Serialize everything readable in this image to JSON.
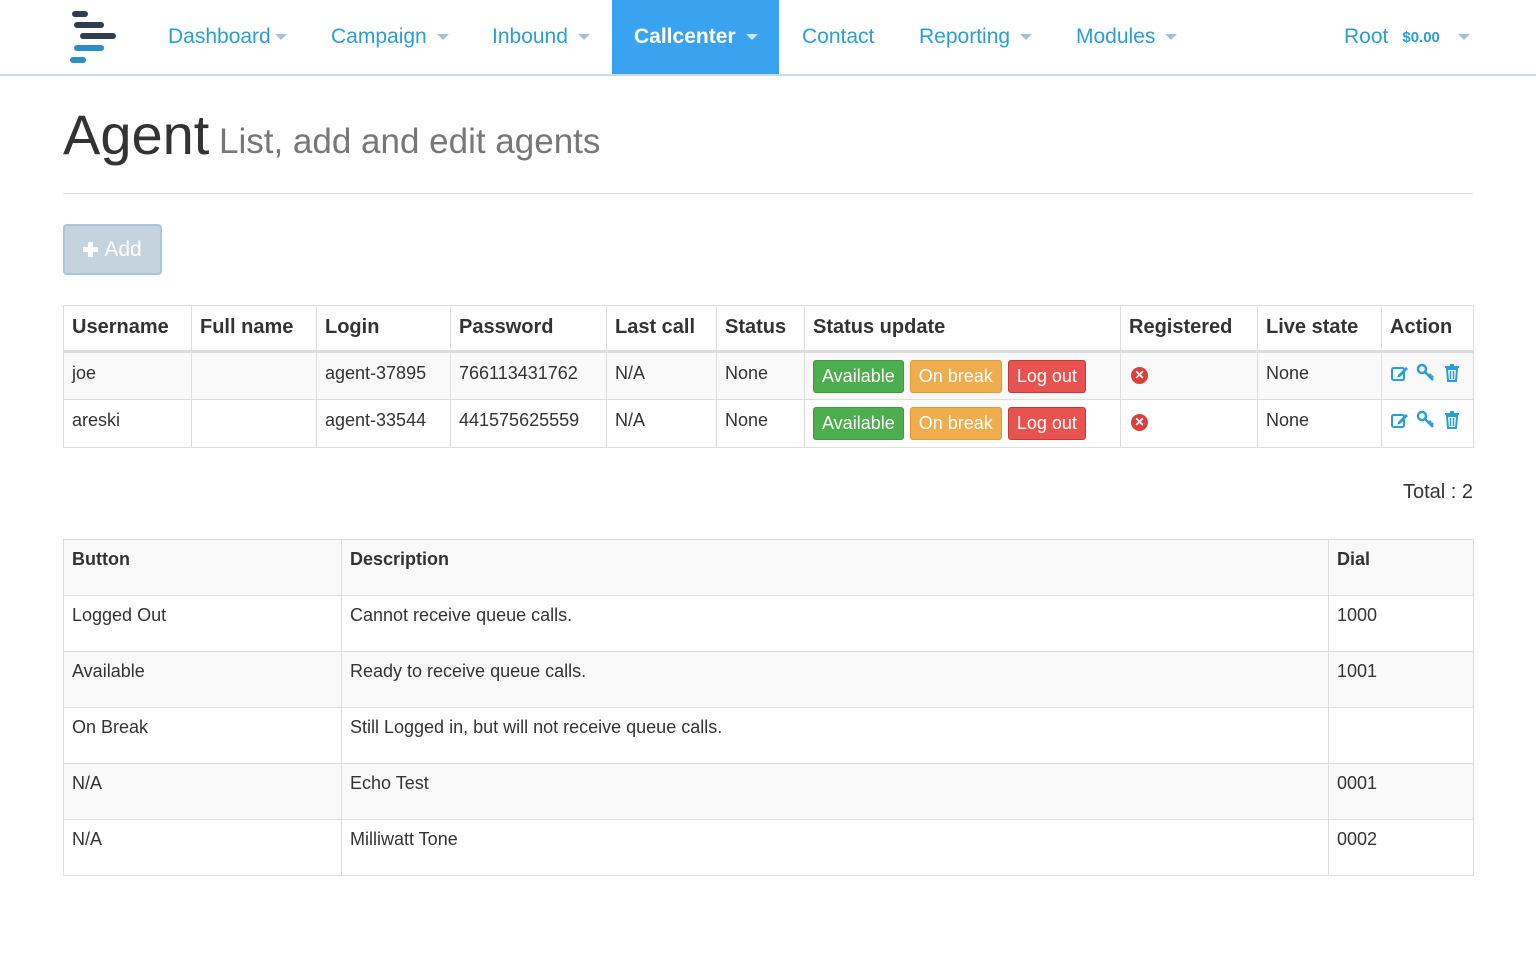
{
  "nav": {
    "items": [
      {
        "label": "Dashboard",
        "caret": true,
        "active": false
      },
      {
        "label": "Campaign",
        "caret": true,
        "active": false
      },
      {
        "label": "Inbound",
        "caret": true,
        "active": false
      },
      {
        "label": "Callcenter",
        "caret": true,
        "active": true
      },
      {
        "label": "Contact",
        "caret": false,
        "active": false
      },
      {
        "label": "Reporting",
        "caret": true,
        "active": false
      },
      {
        "label": "Modules",
        "caret": true,
        "active": false
      }
    ],
    "user": "Root",
    "balance": "$0.00"
  },
  "header": {
    "title": "Agent",
    "subtitle": "List, add and edit agents"
  },
  "add_button": {
    "label": "Add"
  },
  "agents_table": {
    "headers": [
      "Username",
      "Full name",
      "Login",
      "Password",
      "Last call",
      "Status",
      "Status update",
      "Registered",
      "Live state",
      "Action"
    ],
    "status_buttons": {
      "available": "Available",
      "on_break": "On break",
      "log_out": "Log out"
    },
    "rows": [
      {
        "username": "joe",
        "full_name": "",
        "login": "agent-37895",
        "password": "766113431762",
        "last_call": "N/A",
        "status": "None",
        "registered": "no",
        "live_state": "None"
      },
      {
        "username": "areski",
        "full_name": "",
        "login": "agent-33544",
        "password": "441575625559",
        "last_call": "N/A",
        "status": "None",
        "registered": "no",
        "live_state": "None"
      }
    ],
    "total": "Total : 2"
  },
  "legend_table": {
    "headers": [
      "Button",
      "Description",
      "Dial"
    ],
    "rows": [
      {
        "button": "Logged Out",
        "description": "Cannot receive queue calls.",
        "dial": "1000"
      },
      {
        "button": "Available",
        "description": "Ready to receive queue calls.",
        "dial": "1001"
      },
      {
        "button": "On Break",
        "description": "Still Logged in, but will not receive queue calls.",
        "dial": ""
      },
      {
        "button": "N/A",
        "description": "Echo Test",
        "dial": "0001"
      },
      {
        "button": "N/A",
        "description": "Milliwatt Tone",
        "dial": "0002"
      }
    ]
  },
  "icons": {
    "registered": "times-circle-icon",
    "actions": [
      "edit-icon",
      "key-icon",
      "trash-icon"
    ]
  },
  "colors": {
    "link": "#2a9fd6",
    "nav_active_bg": "#3aa3f0",
    "available": "#4cae4c",
    "on_break": "#f0ad4e",
    "log_out": "#e9534f",
    "not_registered": "#d9403c",
    "add_button_bg": "#c4d3de"
  }
}
